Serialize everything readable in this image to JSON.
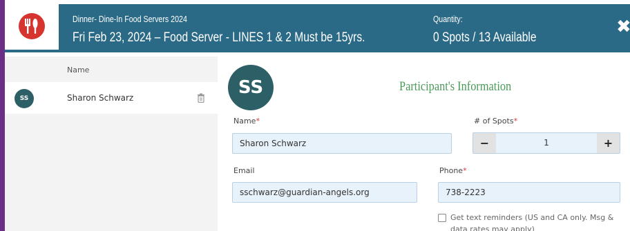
{
  "header": {
    "event_title": "Dinner- Dine-In Food Servers 2024",
    "event_subtitle": "Fri Feb 23, 2024 – Food Server - LINES 1 & 2 Must be 15yrs.",
    "quantity_label": "Quantity:",
    "quantity_value": "0 Spots / 13 Available",
    "close_label": "✖"
  },
  "sidebar": {
    "column_header": "Name",
    "participants": [
      {
        "initials": "SS",
        "name": "Sharon Schwarz"
      }
    ]
  },
  "form": {
    "avatar_initials": "SS",
    "section_title": "Participant's Information",
    "name_label": "Name",
    "name_value": "Sharon Schwarz",
    "spots_label": "# of Spots",
    "spots_value": "1",
    "minus_label": "−",
    "plus_label": "+",
    "email_label": "Email",
    "email_value": "sschwarz@guardian-angels.org",
    "phone_label": "Phone",
    "phone_value": "738-2223",
    "required_mark": "*",
    "text_reminder_label": "Get text reminders (US and CA only. Msg & data rates may apply)"
  },
  "colors": {
    "header_bg": "#2b6a86",
    "accent_strip": "#6a2f86",
    "logo_red": "#d6342e",
    "avatar_bg": "#2d5f66",
    "section_title": "#4a9a5a",
    "required": "#d9363e"
  },
  "icons": {
    "logo": "utensils-icon",
    "close": "close-icon",
    "delete": "trash-icon"
  }
}
